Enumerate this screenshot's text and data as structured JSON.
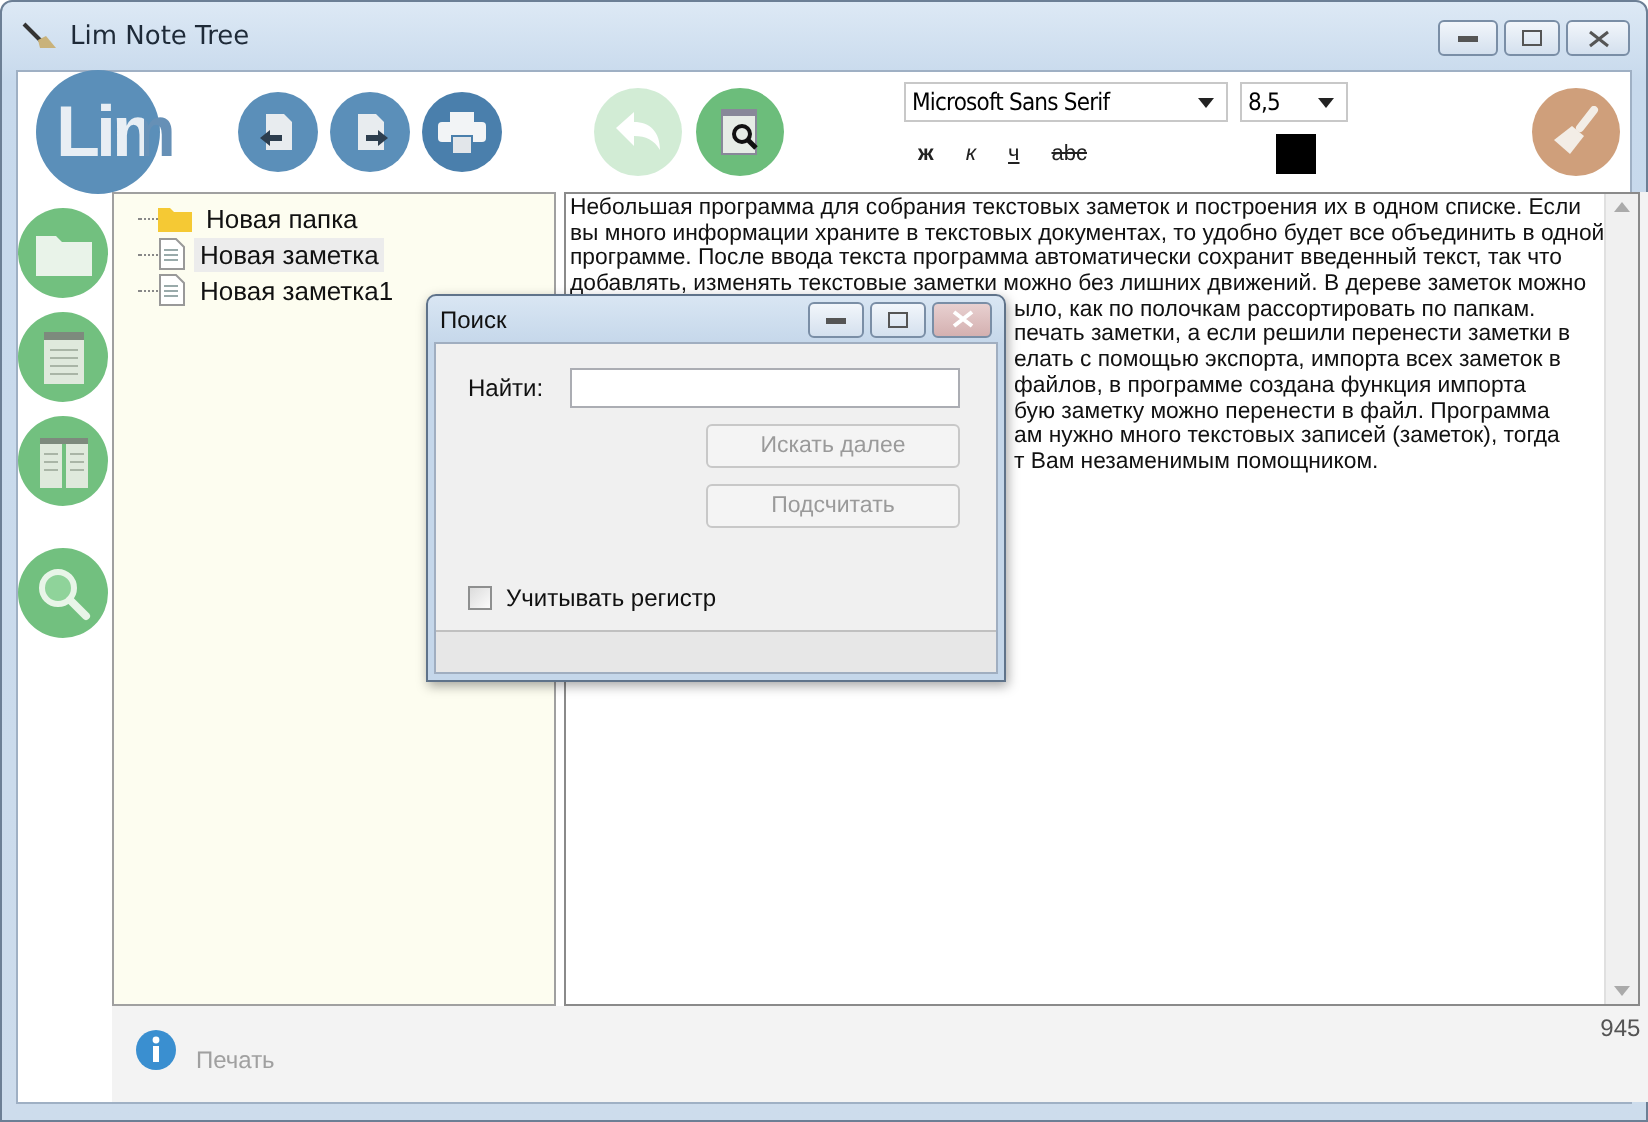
{
  "window": {
    "title": "Lim Note Tree"
  },
  "toolbar": {
    "logo": "Lim",
    "undo_disabled": true,
    "font": "Microsoft Sans Serif",
    "size": "8,5",
    "format_buttons": [
      {
        "label": "ж",
        "kind": "bold"
      },
      {
        "label": "к",
        "kind": "italic"
      },
      {
        "label": "ч",
        "kind": "underline"
      },
      {
        "label": "abc",
        "kind": "strike"
      }
    ]
  },
  "tree": {
    "items": [
      {
        "label": "Новая папка",
        "kind": "folder",
        "selected": false
      },
      {
        "label": "Новая заметка",
        "kind": "note",
        "selected": true
      },
      {
        "label": "Новая заметка1",
        "kind": "note",
        "selected": false
      }
    ]
  },
  "editor": {
    "lines": [
      {
        "text": "Небольшая программа для собрания текстовых заметок и построения их в одном списке. Если",
        "kind": "full"
      },
      {
        "text": "вы много информации храните в текстовых документах, то удобно будет все объединить в одной",
        "kind": "full"
      },
      {
        "text": "программе. После ввода текста программа автоматически сохранит введенный текст, так что",
        "kind": "full"
      },
      {
        "text": "добавлять, изменять текстовые заметки можно без лишних движений. В дереве заметок можно",
        "kind": "full"
      },
      {
        "text": "ыло, как по полочкам рассортировать по папкам.",
        "kind": "partial"
      },
      {
        "text": "печать заметки, а если решили перенести заметки в",
        "kind": "partial"
      },
      {
        "text": "елать с помощью экспорта, импорта всех заметок в",
        "kind": "partial"
      },
      {
        "text": "файлов, в программе создана функция импорта",
        "kind": "partial"
      },
      {
        "text": "бую заметку можно перенести в файл. Программа",
        "kind": "partial"
      },
      {
        "text": "ам нужно много текстовых записей (заметок), тогда",
        "kind": "partial"
      },
      {
        "text": "т Вам незаменимым помощником.",
        "kind": "partial"
      }
    ]
  },
  "status_bar": {
    "label": "Печать",
    "label_disabled": true,
    "count": "945"
  },
  "dialog": {
    "title": "Поиск",
    "find_label": "Найти:",
    "buttons": [
      {
        "label": "Искать далее",
        "disabled": true
      },
      {
        "label": "Подсчитать",
        "disabled": true
      }
    ],
    "checkbox": {
      "label": "Учитывать регистр",
      "checked": false
    }
  }
}
